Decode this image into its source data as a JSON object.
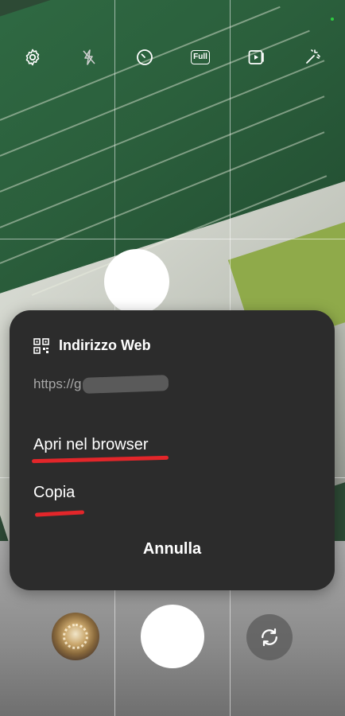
{
  "toolbar": {
    "settings_icon": "gear-icon",
    "flash_icon": "flash-off-icon",
    "timer_icon": "timer-icon",
    "ratio_label": "Full",
    "motion_icon": "motion-photo-icon",
    "filter_icon": "magic-wand-icon"
  },
  "popup": {
    "icon": "qr-code-icon",
    "title": "Indirizzo Web",
    "url": "https://g",
    "actions": [
      {
        "label": "Apri nel browser"
      },
      {
        "label": "Copia"
      }
    ],
    "cancel_label": "Annulla",
    "annotation_color": "#e3262a"
  },
  "camera": {
    "shutter_icon": "shutter-button",
    "gallery_icon": "gallery-thumbnail",
    "switch_icon": "switch-camera-icon"
  }
}
